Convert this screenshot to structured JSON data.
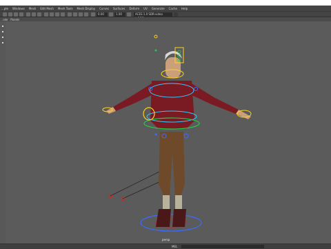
{
  "menubar": {
    "items": [
      "...ple",
      "Windows",
      "Mesh",
      "Edit Mesh",
      "Mesh Tools",
      "Mesh Display",
      "Curves",
      "Surfaces",
      "Deform",
      "UV",
      "Generate",
      "Cache",
      "Help"
    ]
  },
  "toolbar": {
    "field1": "0.00",
    "field2": "1.00",
    "dropdown": "ACES 1.0 SDR-video (sRGB)"
  },
  "panelbar": {
    "items": [
      "..ske",
      "Panels"
    ]
  },
  "viewport": {
    "camera_label": "persp"
  },
  "cmdbar": {
    "language": "MEL"
  },
  "colors": {
    "ui_bg": "#444444",
    "viewport_bg": "#5b5b5b",
    "control_blue": "#3b6bff",
    "control_cyan": "#33ccff",
    "control_yellow": "#ffd21a",
    "control_green": "#22cc44",
    "ik_red": "#dd2222",
    "shirt_red": "#7a1a22",
    "pants_brown": "#6e4a2a"
  }
}
